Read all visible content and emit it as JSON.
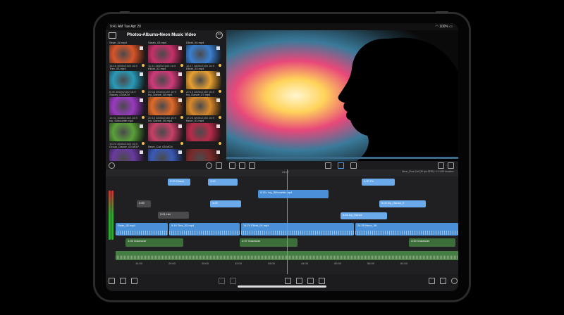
{
  "status_bar": {
    "time": "9:41 AM",
    "date": "Tue Apr 20",
    "battery": "100%"
  },
  "browser": {
    "breadcrumb": "Photos•Albums•Neon Music Video",
    "clips": [
      {
        "name": "Sean_02.mp4",
        "meta": "16:18  3840x2160  16:9",
        "color": "#d8552a"
      },
      {
        "name": "Sarah_03.mp4",
        "meta": "11:11  3840x2160  16:9",
        "color": "#c8306a"
      },
      {
        "name": "Elliott_04.mp4",
        "meta": "16:17  3840x2160  16:9",
        "color": "#3a7fd0"
      },
      {
        "name": "Trev_03.mp4",
        "meta": "6:38  3840x2160  16:9",
        "color": "#2a9ab8"
      },
      {
        "name": "Elliott_02.mp4",
        "meta": "20:06  3840x2160  16:9",
        "color": "#d03a7a"
      },
      {
        "name": "Elliott_03.mp4",
        "meta": "20:15  3840x2160  16:9",
        "color": "#e8a030"
      },
      {
        "name": "Stacey_03.MOV",
        "meta": "15:01  3840x2160  16:9",
        "color": "#9a3ac0"
      },
      {
        "name": "Ivy_Dance_08.mp4",
        "meta": "20:10  3840x2160  16:9",
        "color": "#e06a2a"
      },
      {
        "name": "Ivy_Dance_07.mp4",
        "meta": "17:23  3840x2160  16:9",
        "color": "#d8882a"
      },
      {
        "name": "Ivy_Silhouette.mp4",
        "meta": "10:20  3840x2160  16:9",
        "color": "#5aa03a"
      },
      {
        "name": "Ivy_Dance_06.mp4",
        "meta": "",
        "color": "#c84068"
      },
      {
        "name": "Neon_01.mp4",
        "meta": "",
        "color": "#b82a4a"
      },
      {
        "name": "Group_Dance_03.MOV",
        "meta": "",
        "color": "#6a3aa0"
      },
      {
        "name": "Neon_Car_05.MOV",
        "meta": "",
        "color": "#3a5ab8"
      },
      {
        "name": "",
        "meta": "",
        "color": "#7a2a2a"
      }
    ]
  },
  "timeline": {
    "project_info": "Neon_Flow Cut (30 fps SDR) • 1:11:85 duration",
    "playhead_time": "24:07",
    "ruler": [
      "14:00",
      "20:00",
      "26:00",
      "32:00",
      "38:00",
      "44:00",
      "50:00",
      "56:00",
      "62:00"
    ],
    "upper_clips": [
      {
        "label": "2:23  Classi",
        "kind": "blue-light"
      },
      {
        "label": "3:00",
        "kind": "blue-light"
      },
      {
        "label": "8:15 • Ivy_Silhouette.mp4",
        "kind": "blue"
      },
      {
        "label": "4:00  Ph",
        "kind": "blue-light"
      },
      {
        "label": "2:05",
        "kind": "gray"
      },
      {
        "label": "2:01  Hei",
        "kind": "gray"
      },
      {
        "label": "3:25",
        "kind": "blue-light"
      },
      {
        "label": "5:20  Ivy_Dance_0",
        "kind": "blue-light"
      },
      {
        "label": "5:25  Ivy_Dance",
        "kind": "blue-light"
      }
    ],
    "primary_clips": [
      {
        "label": "Sean_02.mp4"
      },
      {
        "label": "9:19  Trev_02.mp4"
      },
      {
        "label": "14:21  Elliott_04.mp4"
      },
      {
        "label": "24:35  Neon_06"
      }
    ],
    "audio_clips": [
      {
        "label": "1:03  Voiceover"
      },
      {
        "label": "2:37  Voiceover"
      },
      {
        "label": "3:20  Voiceover"
      }
    ]
  }
}
